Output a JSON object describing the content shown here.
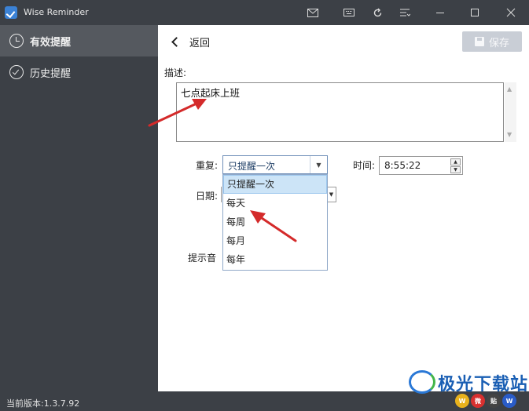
{
  "titlebar": {
    "title": "Wise Reminder",
    "buttons": [
      "mail-icon",
      "keyboard-icon",
      "refresh-icon",
      "settings-icon",
      "minimize-icon",
      "maximize-icon",
      "close-icon"
    ]
  },
  "sidebar": {
    "items": [
      {
        "label": "有效提醒",
        "icon": "clock-icon",
        "active": true
      },
      {
        "label": "历史提醒",
        "icon": "check-circle-icon",
        "active": false
      }
    ],
    "version": "当前版本:1.3.7.92"
  },
  "main": {
    "back_label": "返回",
    "save_label": "保存",
    "desc_label": "描述:",
    "desc_value": "七点起床上班",
    "repeat_label": "重复:",
    "repeat_value": "只提醒一次",
    "time_label": "时间:",
    "time_value": "8:55:22",
    "date_label": "日期:",
    "sound_label": "提示音",
    "repeat_options": [
      "只提醒一次",
      "每天",
      "每周",
      "每月",
      "每年"
    ]
  },
  "watermark": {
    "text": "极光下载站",
    "icons": [
      "W",
      "微",
      "贴",
      "W"
    ]
  },
  "colors": {
    "sidebar_bg": "#3c4046",
    "active_bg": "#55595f",
    "accent": "#3b82d6",
    "annotation_arrow": "#d42a2a"
  }
}
